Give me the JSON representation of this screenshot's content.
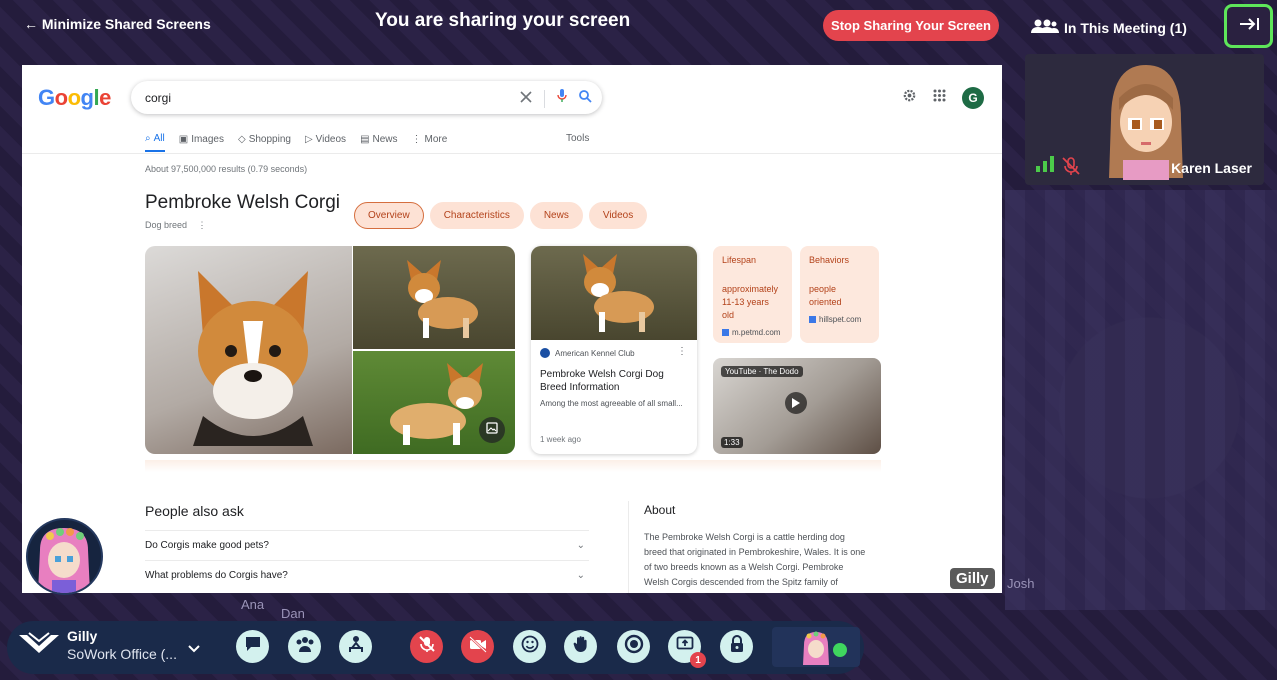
{
  "top": {
    "minimize_label": "← Minimize Shared Screens",
    "sharing_title": "You are sharing your screen",
    "stop_button": "Stop Sharing Your Screen",
    "meeting_label": "In This Meeting (1)"
  },
  "participant": {
    "name": "Karen Laser"
  },
  "google": {
    "logo": [
      "G",
      "o",
      "o",
      "g",
      "l",
      "e"
    ],
    "query": "corgi",
    "avatar_letter": "G",
    "tabs": [
      "All",
      "Images",
      "Shopping",
      "Videos",
      "News",
      "More"
    ],
    "tools": "Tools",
    "results_count": "About 97,500,000 results (0.79 seconds)",
    "knowledge_panel": {
      "title": "Pembroke Welsh Corgi",
      "subtitle": "Dog breed",
      "chips": [
        "Overview",
        "Characteristics",
        "News",
        "Videos"
      ]
    },
    "card": {
      "source": "American Kennel Club",
      "title": "Pembroke Welsh Corgi Dog Breed Information",
      "snippet": "Among the most agreeable of all small...",
      "date": "1 week ago"
    },
    "facts": [
      {
        "label": "Lifespan",
        "value": "approximately 11-13 years old",
        "source": "m.petmd.com"
      },
      {
        "label": "Behaviors",
        "value": "people oriented",
        "source": "hillspet.com"
      }
    ],
    "video": {
      "source": "YouTube · The Dodo",
      "duration": "1:33"
    },
    "people_also_ask": {
      "title": "People also ask",
      "questions": [
        "Do Corgis make good pets?",
        "What problems do Corgis have?"
      ]
    },
    "about": {
      "title": "About",
      "text": "The Pembroke Welsh Corgi is a cattle herding dog breed that originated in Pembrokeshire, Wales. It is one of two breeds known as a Welsh Corgi. Pembroke Welsh Corgis descended from the Spitz family of"
    }
  },
  "screen_owner_tag": "Gilly",
  "world_labels": [
    "Josh",
    "Ana",
    "Dan"
  ],
  "bottom": {
    "user_name": "Gilly",
    "office": "SoWork Office (...",
    "screen_badge": "1"
  },
  "colors": {
    "accent_red": "#e3444d",
    "highlight_green": "#5ee65a",
    "control_bg": "#d3f1ee"
  }
}
